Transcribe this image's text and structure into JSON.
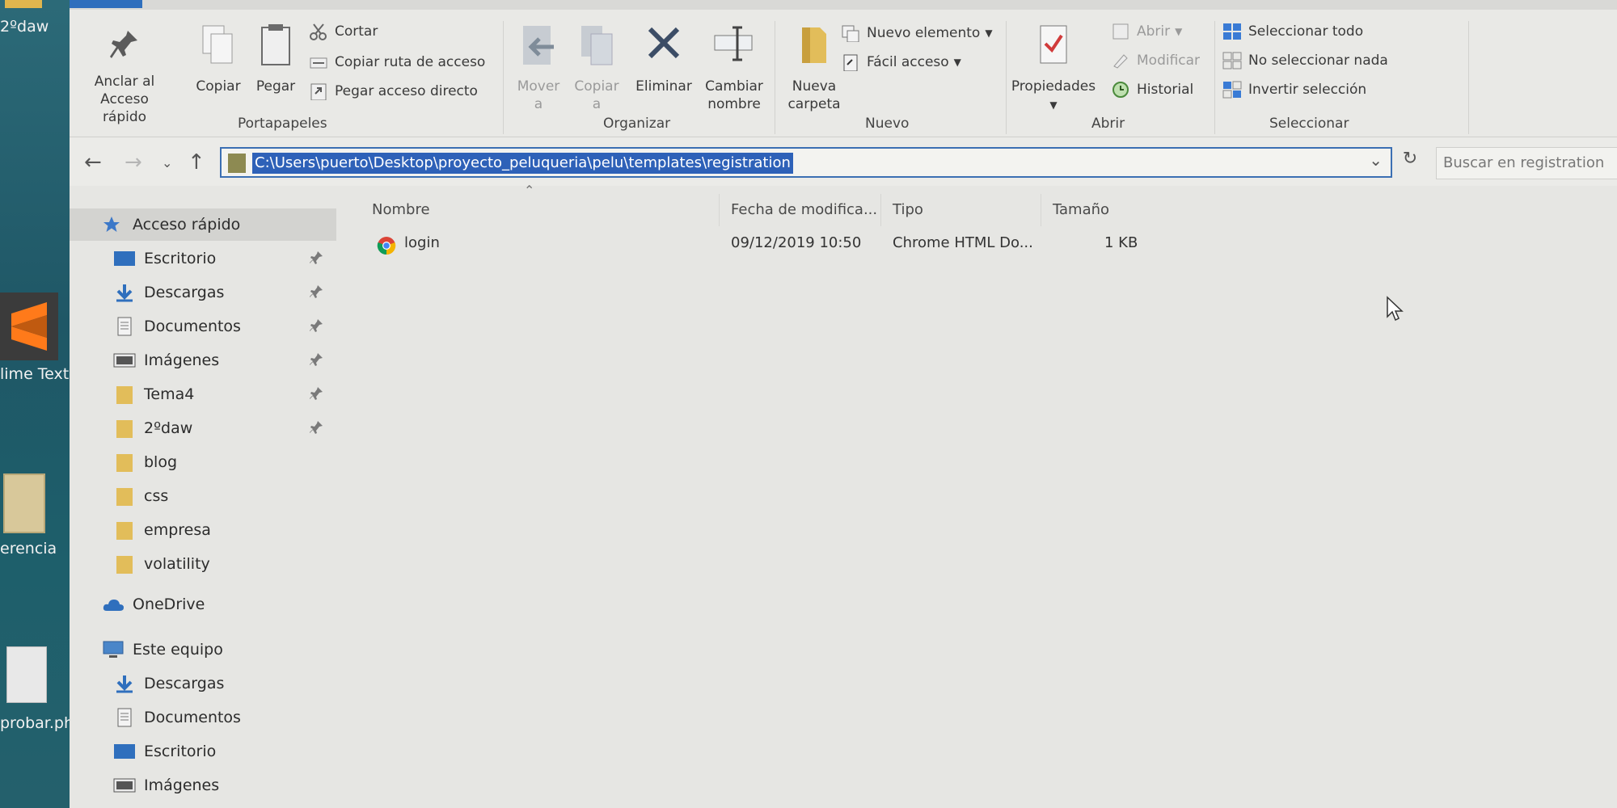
{
  "desktop": {
    "labels": [
      "2ºdaw",
      "lime Text",
      "erencia",
      "probar.ph"
    ]
  },
  "ribbon": {
    "portapapeles": {
      "group_label": "Portapapeles",
      "pin_label_1": "Anclar al",
      "pin_label_2": "Acceso rápido",
      "copy": "Copiar",
      "paste": "Pegar",
      "cut": "Cortar",
      "copy_path": "Copiar ruta de acceso",
      "paste_shortcut": "Pegar acceso directo"
    },
    "organizar": {
      "group_label": "Organizar",
      "move_1": "Mover",
      "move_2": "a",
      "copy_to_1": "Copiar",
      "copy_to_2": "a",
      "delete": "Eliminar",
      "rename_1": "Cambiar",
      "rename_2": "nombre"
    },
    "nuevo": {
      "group_label": "Nuevo",
      "new_folder_1": "Nueva",
      "new_folder_2": "carpeta",
      "new_item": "Nuevo elemento",
      "easy_access": "Fácil acceso"
    },
    "abrir": {
      "group_label": "Abrir",
      "properties": "Propiedades",
      "open": "Abrir",
      "edit": "Modificar",
      "history": "Historial"
    },
    "seleccionar": {
      "group_label": "Seleccionar",
      "select_all": "Seleccionar todo",
      "select_none": "No seleccionar nada",
      "invert": "Invertir selección"
    }
  },
  "address": {
    "path": "C:\\Users\\puerto\\Desktop\\proyecto_peluqueria\\pelu\\templates\\registration",
    "search_placeholder": "Buscar en registration"
  },
  "sidebar": {
    "quick_access": "Acceso rápido",
    "quick_items": [
      {
        "label": "Escritorio",
        "pinned": true
      },
      {
        "label": "Descargas",
        "pinned": true
      },
      {
        "label": "Documentos",
        "pinned": true
      },
      {
        "label": "Imágenes",
        "pinned": true
      },
      {
        "label": "Tema4",
        "pinned": true
      },
      {
        "label": "2ºdaw",
        "pinned": true
      },
      {
        "label": "blog",
        "pinned": false
      },
      {
        "label": "css",
        "pinned": false
      },
      {
        "label": "empresa",
        "pinned": false
      },
      {
        "label": "volatility",
        "pinned": false
      }
    ],
    "onedrive": "OneDrive",
    "this_pc": "Este equipo",
    "pc_items": [
      "Descargas",
      "Documentos",
      "Escritorio",
      "Imágenes"
    ]
  },
  "file_list": {
    "columns": [
      "Nombre",
      "Fecha de modifica...",
      "Tipo",
      "Tamaño"
    ],
    "rows": [
      {
        "name": "login",
        "modified": "09/12/2019 10:50",
        "type": "Chrome HTML Do...",
        "size": "1 KB"
      }
    ]
  },
  "colors": {
    "accent": "#2e61b8",
    "folder": "#e2bd5a",
    "desktop": "#1f5766"
  }
}
